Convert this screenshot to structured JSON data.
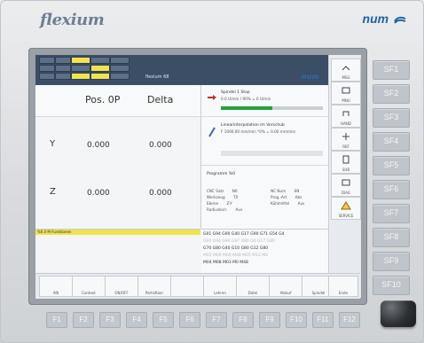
{
  "brand": {
    "left": "flexium",
    "right": "num"
  },
  "topbar": {
    "label": "flexium 68",
    "num": "num"
  },
  "axes": {
    "header": {
      "col1": "Pos. 0P",
      "col2": "Delta"
    },
    "rows": [
      {
        "axis": "Y",
        "pos": "0.000",
        "delta": "0.000"
      },
      {
        "axis": "Z",
        "pos": "0.000",
        "delta": "0.000"
      }
    ]
  },
  "status": {
    "spindle": {
      "title": "Spindel 1 Stop",
      "detail": "0.0 U/min / 90% = 0 U/min",
      "progress_fraction": 0.5
    },
    "interpolation": {
      "title": "Linearinterpolation im Vorschub",
      "detail": "F 1000.00 mm/min *0% = 0.00 mm/min"
    },
    "program": "Programm %0"
  },
  "info": {
    "left": [
      {
        "k": "CNC Satz",
        "v": "N0"
      },
      {
        "k": "Werkzeug",
        "v": "T0"
      },
      {
        "k": "Ebene",
        "v": "Z-Y"
      },
      {
        "k": "Radiuskorr.",
        "v": "Aus"
      }
    ],
    "right": [
      {
        "k": "NC Num",
        "v": "EN"
      },
      {
        "k": "Prog.-Art",
        "v": "Abs"
      },
      {
        "k": "Kühlmittel",
        "v": "Aus"
      }
    ]
  },
  "message": "%0.0 M-Funktionen",
  "gcode_lines": [
    "G01 G94 G90 G40 G17 G90 G71 G54 G4",
    "G94 G94 G90 G97 G80 G0 G17 G80",
    "G70 G80 G40 G10 G80 G12 G80",
    "M05 M00 M09 M48 M05 M12 M0",
    "M04 M08 M03 M0 M48"
  ],
  "sidebar": [
    {
      "label": "MSG"
    },
    {
      "label": "MNU"
    },
    {
      "label": "HAND"
    },
    {
      "label": "REF"
    },
    {
      "label": "SUB"
    },
    {
      "label": "DIAG"
    },
    {
      "label": "SERVICE"
    }
  ],
  "softkeys": [
    {
      "label": "Afb"
    },
    {
      "label": "Context"
    },
    {
      "label": "ON/OFF"
    },
    {
      "label": "Parts/Koor"
    },
    {
      "label": ""
    },
    {
      "label": "Lehren"
    },
    {
      "label": "Datei"
    },
    {
      "label": "Ablauf"
    },
    {
      "label": "Spindel"
    },
    {
      "label": "Ende"
    }
  ],
  "sf_keys": [
    "SF1",
    "SF2",
    "SF3",
    "SF4",
    "SF5",
    "SF6",
    "SF7",
    "SF8",
    "SF9",
    "SF10"
  ],
  "f_keys": [
    "F1",
    "F2",
    "F3",
    "F4",
    "F5",
    "F6",
    "F7",
    "F8",
    "F9",
    "F10",
    "F11",
    "F12"
  ]
}
